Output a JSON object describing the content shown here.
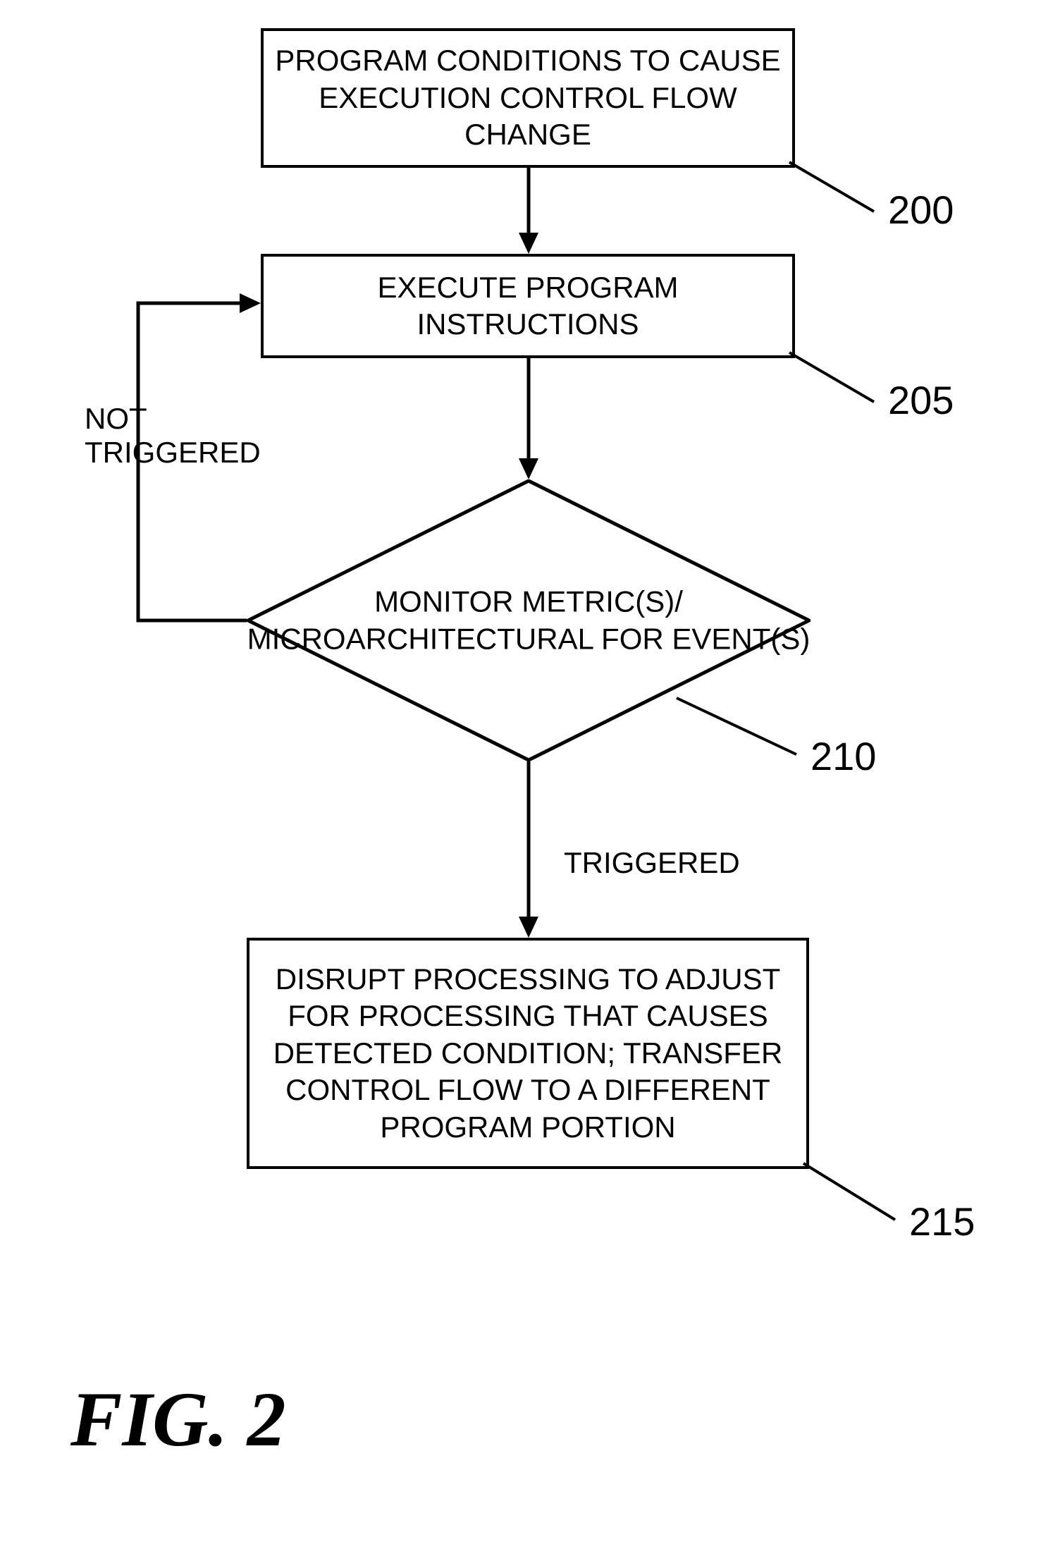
{
  "figure_label": "FIG. 2",
  "boxes": {
    "b200": "PROGRAM CONDITIONS TO CAUSE\nEXECUTION CONTROL FLOW\nCHANGE",
    "b205": "EXECUTE PROGRAM\nINSTRUCTIONS",
    "b210": "MONITOR METRIC(S)/\nMICROARCHITECTURAL FOR\nEVENT(S)",
    "b215": "DISRUPT PROCESSING TO ADJUST\nFOR PROCESSING THAT CAUSES\nDETECTED CONDITION; TRANSFER\nCONTROL FLOW TO A DIFFERENT\nPROGRAM PORTION"
  },
  "edge_labels": {
    "not_triggered": "NOT\nTRIGGERED",
    "triggered": "TRIGGERED"
  },
  "callouts": {
    "b200": "200",
    "b205": "205",
    "b210": "210",
    "b215": "215"
  }
}
